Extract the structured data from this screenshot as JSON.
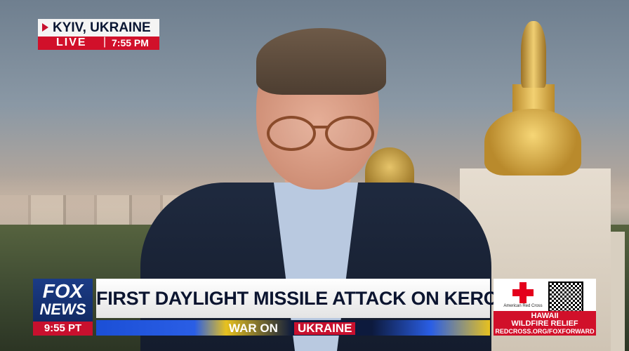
{
  "location": {
    "city": "KYIV, UKRAINE",
    "live_label": "LIVE",
    "separator": "|",
    "time": "7:55 PM"
  },
  "logo": {
    "line1": "FOX",
    "line2": "NEWS",
    "time": "9:55 PT"
  },
  "banner": {
    "headline": "FIRST DAYLIGHT MISSILE ATTACK ON KERCH BRIDGE",
    "subline_prefix": "WAR ON",
    "subline_highlight": "UKRAINE"
  },
  "promo": {
    "org": "American Red Cross",
    "line1": "HAWAII",
    "line2": "WILDFIRE RELIEF",
    "url": "REDCROSS.ORG/FOXFORWARD"
  },
  "colors": {
    "brand_red": "#d1102a",
    "navy": "#0c1530",
    "fox_blue": "#1b3c86",
    "ukraine_blue": "#2a5ee5",
    "ukraine_yellow": "#e7c11f"
  }
}
